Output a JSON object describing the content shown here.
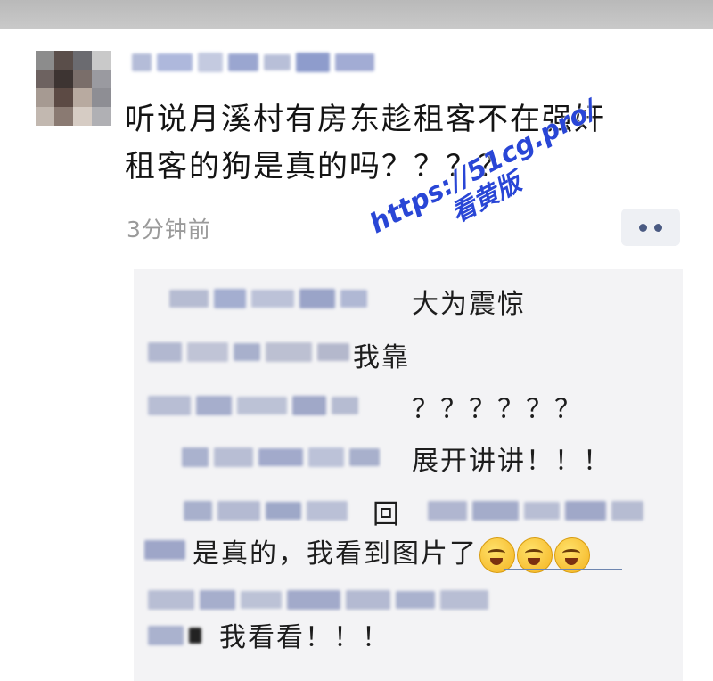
{
  "post": {
    "text_line1": "听说月溪村有房东趁租客不在强奸",
    "text_line2": "租客的狗是真的吗？？？？",
    "timestamp": "3分钟前"
  },
  "comments": [
    {
      "text": "大为震惊"
    },
    {
      "text": "我靠"
    },
    {
      "text": "？？？？？？"
    },
    {
      "text": "展开讲讲！！！"
    },
    {
      "text": "回"
    },
    {
      "text": "是真的，我看到图片了"
    },
    {
      "text": "我看看！！！"
    }
  ],
  "watermark": {
    "line1": "https://51cg.pro/",
    "line2": "看黄版"
  },
  "icons": {
    "more": "more-dots-icon",
    "emoji": "crying-laughing-emoji"
  }
}
